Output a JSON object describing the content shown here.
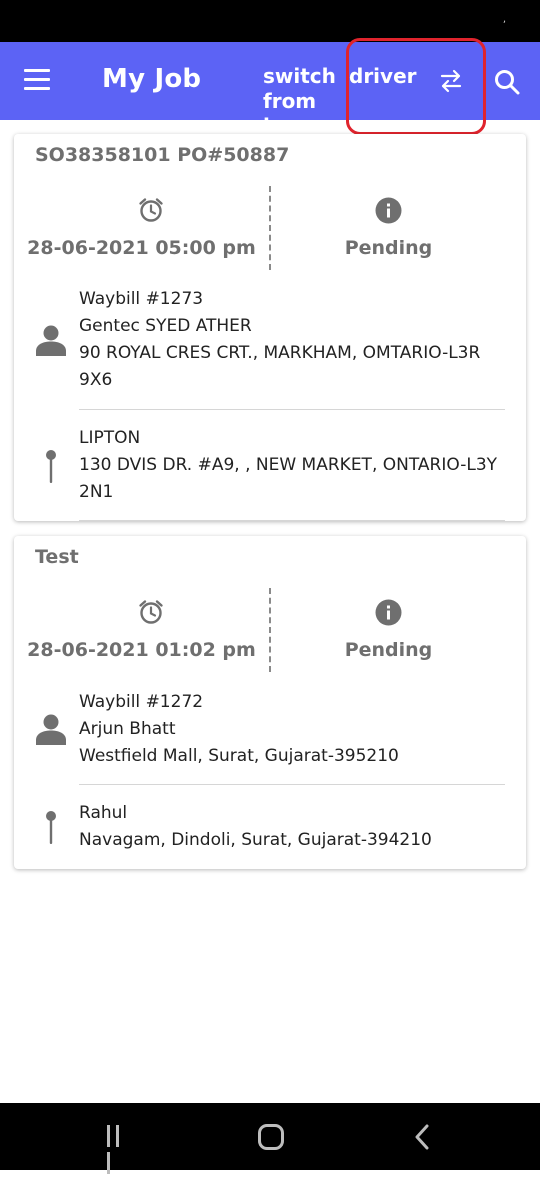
{
  "app_bar": {
    "title": "My Job",
    "switch_line1": "switch",
    "switch_line2": "from her",
    "driver_label": "driver",
    "color": "#5c63f5",
    "icons": [
      "menu-icon",
      "swap-icon",
      "search-icon"
    ]
  },
  "jobs": [
    {
      "title": "SO38358101 PO#50887",
      "datetime": "28-06-2021 05:00 pm",
      "status": "Pending",
      "pickup": {
        "waybill": "Waybill #1273",
        "name": "Gentec SYED ATHER",
        "address_line1": "90 ROYAL CRES CRT., MARKHAM, OMTARIO-L3R",
        "address_line2": "9X6"
      },
      "drop": {
        "name": "LIPTON",
        "address_line1": "130 DVIS DR. #A9, , NEW MARKET, ONTARIO-L3Y",
        "address_line2": "2N1"
      }
    },
    {
      "title": "Test",
      "datetime": "28-06-2021 01:02 pm",
      "status": "Pending",
      "pickup": {
        "waybill": "Waybill #1272",
        "name": "Arjun Bhatt",
        "address_line1": "Westfield Mall, Surat, Gujarat-395210"
      },
      "drop": {
        "name": "Rahul",
        "address_line1": "Navagam, Dindoli, Surat, Gujarat-394210"
      }
    }
  ],
  "nav": {
    "icons": [
      "recent-apps-icon",
      "home-icon",
      "back-icon"
    ]
  },
  "colors": {
    "accent": "#5c63f5",
    "highlight": "#e0242d",
    "muted_text": "#6f6f6f"
  }
}
